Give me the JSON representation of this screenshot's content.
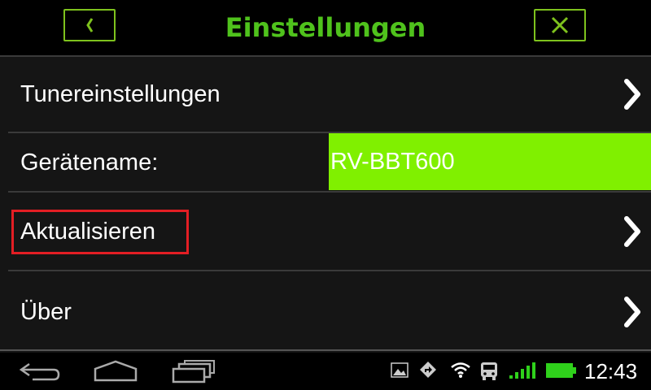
{
  "header": {
    "title": "Einstellungen",
    "back_icon": "chevron-left-icon",
    "close_icon": "close-icon",
    "accent_color": "#4fc21c"
  },
  "settings": {
    "tuner_label": "Tunereinstellungen",
    "device_name_label": "Gerätename:",
    "device_name_value": "RV-BBT600",
    "update_label": "Aktualisieren",
    "about_label": "Über"
  },
  "statusbar": {
    "time": "12:43",
    "battery_color": "#2fd11b",
    "icons": [
      "picture-icon",
      "navigation-icon",
      "wifi-icon",
      "bus-icon",
      "signal-icon",
      "battery-icon"
    ]
  },
  "navbar": {
    "icons": [
      "back-nav-icon",
      "home-icon",
      "recent-apps-icon"
    ]
  }
}
